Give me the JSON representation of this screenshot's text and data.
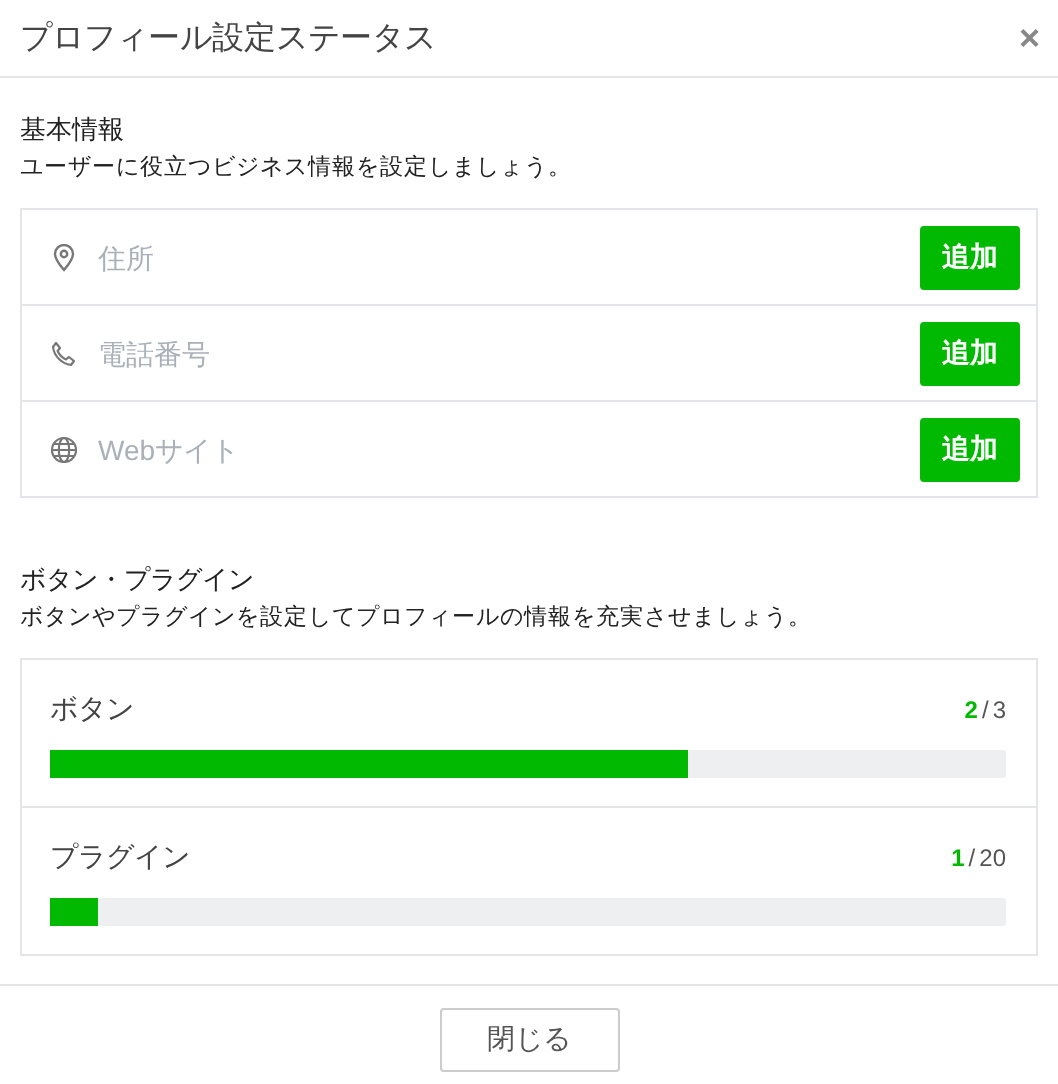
{
  "dialog": {
    "title": "プロフィール設定ステータス",
    "close": "×"
  },
  "basic_info": {
    "heading": "基本情報",
    "description": "ユーザーに役立つビジネス情報を設定しましょう。",
    "fields": [
      {
        "kind": "location",
        "placeholder": "住所",
        "button": "追加"
      },
      {
        "kind": "phone",
        "placeholder": "電話番号",
        "button": "追加"
      },
      {
        "kind": "web",
        "placeholder": "Webサイト",
        "button": "追加"
      }
    ]
  },
  "buttons_plugins": {
    "heading": "ボタン・プラグイン",
    "description": "ボタンやプラグインを設定してプロフィールの情報を充実させましょう。",
    "items": [
      {
        "label": "ボタン",
        "done": "2",
        "separator": "/",
        "total": "3",
        "level": 0.667
      },
      {
        "label": "プラグイン",
        "done": "1",
        "separator": "/",
        "total": "20",
        "level": 0.05
      }
    ]
  },
  "footer": {
    "button": "閉じる"
  }
}
